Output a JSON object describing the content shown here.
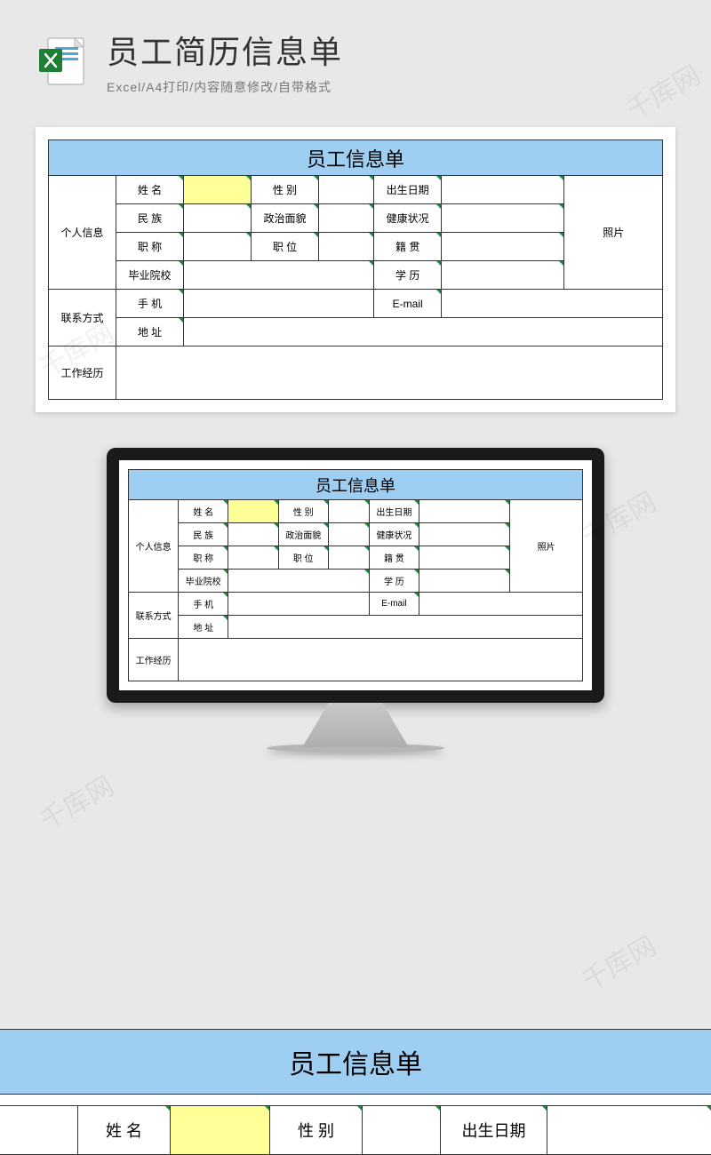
{
  "header": {
    "title": "员工简历信息单",
    "subtitle": "Excel/A4打印/内容随意修改/自带格式"
  },
  "form": {
    "title": "员工信息单",
    "sections": {
      "personal": "个人信息",
      "contact": "联系方式",
      "work": "工作经历"
    },
    "labels": {
      "name": "姓 名",
      "gender": "性 别",
      "birth": "出生日期",
      "ethnic": "民 族",
      "political": "政治面貌",
      "health": "健康状况",
      "title": "职 称",
      "position": "职 位",
      "native": "籍 贯",
      "school": "毕业院校",
      "edu": "学 历",
      "phone": "手 机",
      "email": "E-mail",
      "address": "地 址",
      "photo": "照片"
    }
  },
  "watermark": "千库网"
}
